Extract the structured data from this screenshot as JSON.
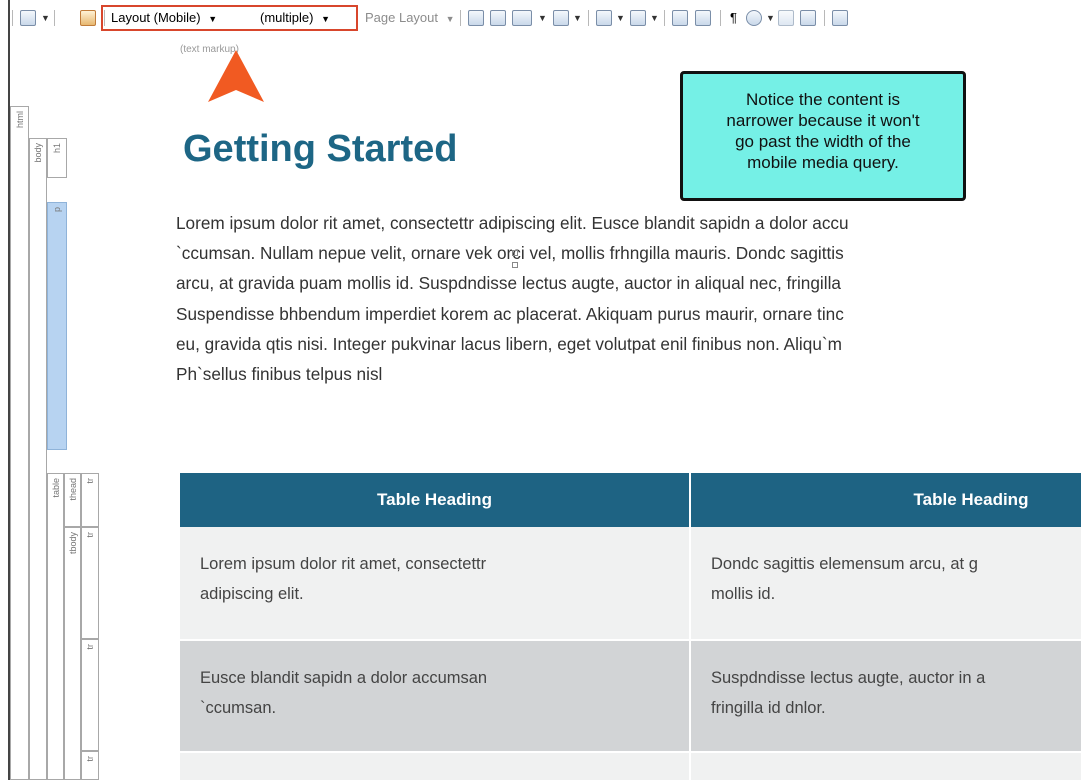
{
  "toolbar": {
    "layout_label": "Layout (Mobile)",
    "medium_label": "(multiple)",
    "page_layout_label": "Page Layout"
  },
  "markup_hint": "(text markup)",
  "structure_bars": {
    "html": "html",
    "body": "body",
    "h1": "h1",
    "p": "p",
    "table": "table",
    "thead": "thead",
    "tbody": "tbody",
    "tr": "tr"
  },
  "callout": {
    "lines": [
      "Notice the content is",
      "narrower because it won't",
      "go past the width of the",
      "mobile media query."
    ]
  },
  "document": {
    "heading": "Getting Started",
    "paragraph_lines": [
      "Lorem ipsum dolor rit amet, consectettr adipiscing elit. Eusce blandit sapidn a dolor accu",
      "`ccumsan. Nullam nepue velit, ornare vek orci vel, mollis frhngilla mauris. Dondc sagittis",
      "arcu, at gravida puam mollis id. Suspdndisse lectus augte, auctor in aliqual nec, fringilla",
      "Suspendisse bhbendum imperdiet korem ac placerat. Akiquam purus maurir, ornare tinc",
      "eu, gravida qtis nisi. Integer pukvinar lacus libern, eget volutpat enil finibus non. Aliqu`m",
      "Ph`sellus finibus telpus nisl"
    ],
    "table": {
      "headers": [
        "Table Heading",
        "Table Heading"
      ],
      "rows": [
        [
          "Lorem ipsum dolor rit amet, consectettr|adipiscing elit.",
          "Dondc sagittis elemensum arcu, at g|mollis id."
        ],
        [
          "Eusce blandit sapidn a dolor accumsan|`ccumsan.",
          "Suspdndisse lectus augte, auctor in a|fringilla id dnlor."
        ],
        [
          "",
          ""
        ]
      ]
    }
  },
  "colors": {
    "accent_red": "#d8462c",
    "heading_teal": "#1d6685",
    "table_header_bg": "#1e6383",
    "callout_bg": "#75f0e6",
    "structure_selected": "#b7d3f1"
  }
}
